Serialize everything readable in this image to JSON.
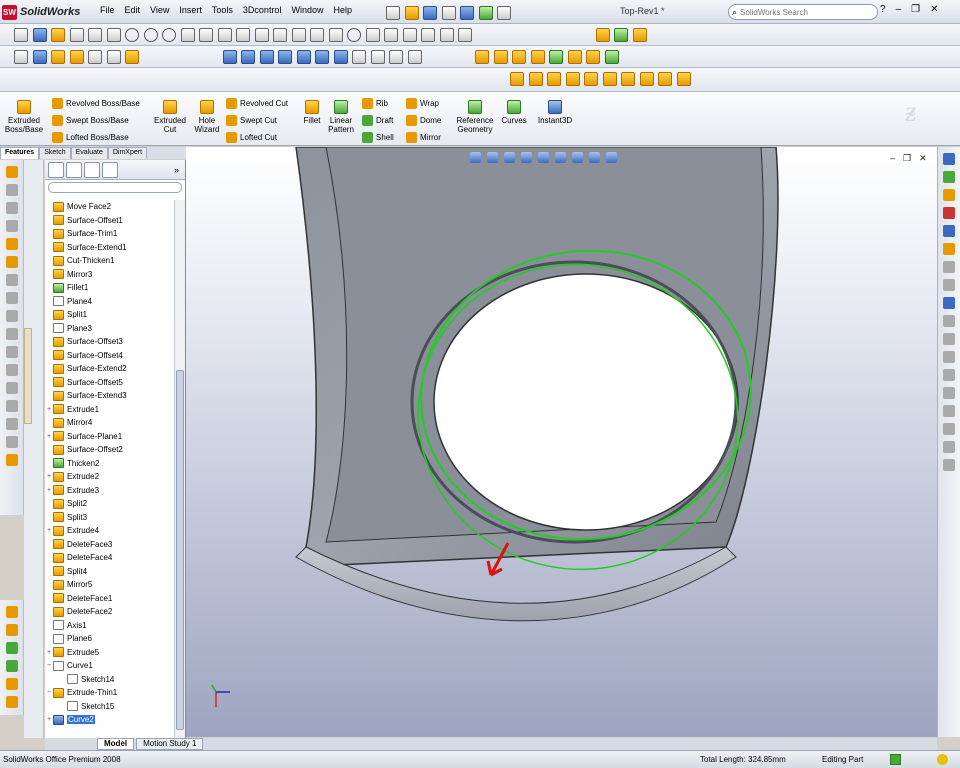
{
  "app": {
    "logo_text": "SolidWorks",
    "doc_title": "Top-Rev1 *"
  },
  "menu": [
    "File",
    "Edit",
    "View",
    "Insert",
    "Tools",
    "3Dcontrol",
    "Window",
    "Help"
  ],
  "search": {
    "placeholder": "SolidWorks Search"
  },
  "command_manager": {
    "extruded_boss": "Extruded Boss/Base",
    "revolved_boss": "Revolved Boss/Base",
    "swept_boss": "Swept Boss/Base",
    "lofted_boss": "Lofted Boss/Base",
    "extruded_cut": "Extruded Cut",
    "hole_wizard": "Hole Wizard",
    "revolved_cut": "Revolved Cut",
    "swept_cut": "Swept Cut",
    "lofted_cut": "Lofted Cut",
    "fillet": "Fillet",
    "linear_pattern": "Linear Pattern",
    "rib": "Rib",
    "draft": "Draft",
    "shell": "Shell",
    "wrap": "Wrap",
    "dome": "Dome",
    "mirror": "Mirror",
    "reference_geometry": "Reference Geometry",
    "curves": "Curves",
    "instant3d": "Instant3D"
  },
  "tabs": [
    "Features",
    "Sketch",
    "Evaluate",
    "DimXpert"
  ],
  "tree": [
    {
      "label": "Move Face2",
      "icon": "y"
    },
    {
      "label": "Surface-Offset1",
      "icon": "y"
    },
    {
      "label": "Surface-Trim1",
      "icon": "y"
    },
    {
      "label": "Surface-Extend1",
      "icon": "y"
    },
    {
      "label": "Cut-Thicken1",
      "icon": "y"
    },
    {
      "label": "Mirror3",
      "icon": "y"
    },
    {
      "label": "Fillet1",
      "icon": "g"
    },
    {
      "label": "Plane4",
      "icon": "o"
    },
    {
      "label": "Split1",
      "icon": "y"
    },
    {
      "label": "Plane3",
      "icon": "o"
    },
    {
      "label": "Surface-Offset3",
      "icon": "y"
    },
    {
      "label": "Surface-Offset4",
      "icon": "y"
    },
    {
      "label": "Surface-Extend2",
      "icon": "y"
    },
    {
      "label": "Surface-Offset5",
      "icon": "y"
    },
    {
      "label": "Surface-Extend3",
      "icon": "y"
    },
    {
      "label": "Extrude1",
      "icon": "y",
      "exp": "+"
    },
    {
      "label": "Mirror4",
      "icon": "y"
    },
    {
      "label": "Surface-Plane1",
      "icon": "y",
      "exp": "+"
    },
    {
      "label": "Surface-Offset2",
      "icon": "y"
    },
    {
      "label": "Thicken2",
      "icon": "g"
    },
    {
      "label": "Extrude2",
      "icon": "y",
      "exp": "+"
    },
    {
      "label": "Extrude3",
      "icon": "y",
      "exp": "+"
    },
    {
      "label": "Split2",
      "icon": "y"
    },
    {
      "label": "Split3",
      "icon": "y"
    },
    {
      "label": "Extrude4",
      "icon": "y",
      "exp": "+"
    },
    {
      "label": "DeleteFace3",
      "icon": "y"
    },
    {
      "label": "DeleteFace4",
      "icon": "y"
    },
    {
      "label": "Split4",
      "icon": "y"
    },
    {
      "label": "Mirror5",
      "icon": "y"
    },
    {
      "label": "DeleteFace1",
      "icon": "y"
    },
    {
      "label": "DeleteFace2",
      "icon": "y"
    },
    {
      "label": "Axis1",
      "icon": "o"
    },
    {
      "label": "Plane6",
      "icon": "o"
    },
    {
      "label": "Extrude5",
      "icon": "y",
      "exp": "+"
    },
    {
      "label": "Curve1",
      "icon": "o",
      "exp": "−"
    },
    {
      "label": "Sketch14",
      "icon": "o",
      "child": true
    },
    {
      "label": "Extrude-Thin1",
      "icon": "y",
      "exp": "−"
    },
    {
      "label": "Sketch15",
      "icon": "o",
      "child": true
    },
    {
      "label": "Curve2",
      "icon": "b",
      "exp": "+",
      "selected": true
    }
  ],
  "bottom_tabs": [
    "Model",
    "Motion Study 1"
  ],
  "status": {
    "product": "SolidWorks Office Premium 2008",
    "total_length": "Total Length: 324.85mm",
    "mode": "Editing Part"
  },
  "colors": {
    "accent": "#3173d8",
    "curve": "#22cc22",
    "arrow": "#e01010"
  }
}
